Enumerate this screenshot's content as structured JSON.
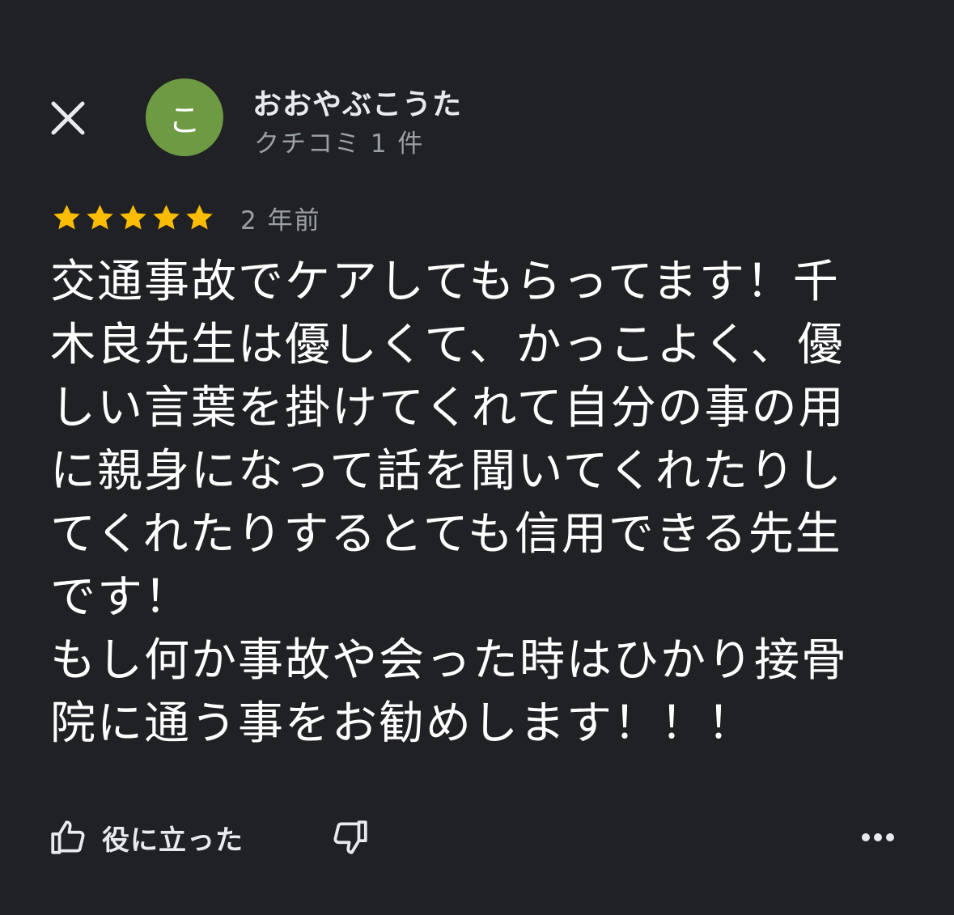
{
  "header": {
    "close_icon": "close-icon",
    "avatar_letter": "こ",
    "avatar_color": "#6e9a44",
    "author_name": "おおやぶこうた",
    "author_meta": "クチコミ 1 件"
  },
  "review": {
    "rating": 5,
    "rating_max": 5,
    "star_color": "#fbbc04",
    "date": "2 年前",
    "text": "交通事故でケアしてもらってます！千木良先生は優しくて、かっこよく、優しい言葉を掛けてくれて自分の事の用に親身になって話を聞いてくれたりしてくれたりするとても信用できる先生です！\nもし何か事故や会った時はひかり接骨院に通う事をお勧めします！！！"
  },
  "actions": {
    "helpful_label": "役に立った",
    "helpful_icon": "thumbs-up-icon",
    "not_helpful_icon": "thumbs-down-icon",
    "more_icon": "more-horizontal-icon"
  }
}
